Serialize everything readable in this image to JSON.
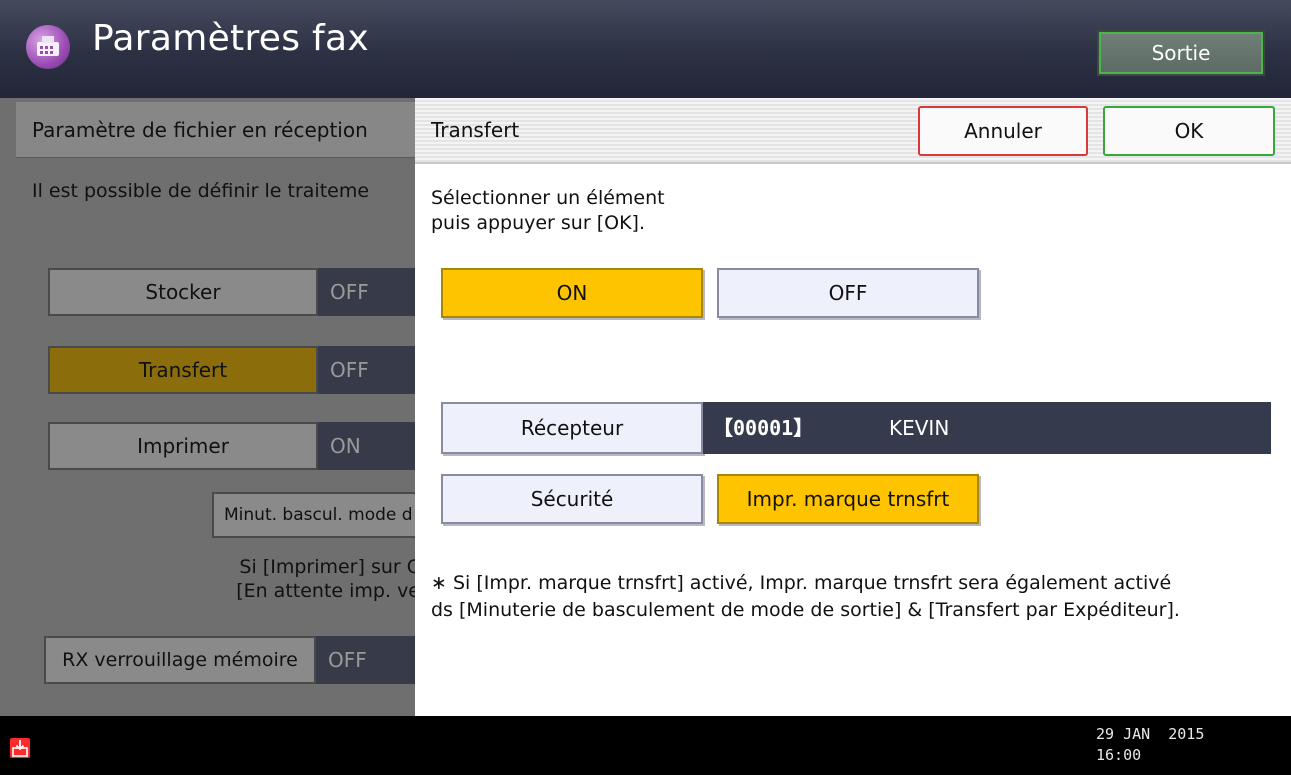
{
  "header": {
    "title": "Paramètres fax",
    "exit_label": "Sortie",
    "icon": "fax-icon"
  },
  "background_panel": {
    "title": "Paramètre de fichier en réception",
    "description": "Il est possible de définir le traiteme",
    "settings": [
      {
        "label": "Stocker",
        "value": "OFF",
        "selected": false
      },
      {
        "label": "Transfert",
        "value": "OFF",
        "selected": true
      },
      {
        "label": "Imprimer",
        "value": "ON",
        "selected": false
      }
    ],
    "sub_button_label": "Minut. bascul. mode d",
    "note_line1": "Si [Imprimer] sur C",
    "note_line2": "[En attente imp. ve",
    "memory_lock": {
      "label": "RX verrouillage mémoire",
      "value": "OFF"
    }
  },
  "dialog": {
    "title": "Transfert",
    "cancel_label": "Annuler",
    "ok_label": "OK",
    "instruction_line1": "Sélectionner un élément",
    "instruction_line2": "puis appuyer sur [OK].",
    "on_label": "ON",
    "off_label": "OFF",
    "selected_option": "ON",
    "receiver_label": "Récepteur",
    "receiver_number": "【00001】",
    "receiver_name": "KEVIN",
    "security_label": "Sécurité",
    "stamp_label": "Impr. marque trnsfrt",
    "note_line1": "∗ Si [Impr. marque trnsfrt] activé, Impr. marque trnsfrt sera également activé",
    "note_line2": "ds [Minuterie de basculement de mode de sortie] & [Transfert par Expéditeur]."
  },
  "footer": {
    "date": "29 JAN  2015",
    "time": "16:00",
    "icon": "inbox-alert-icon"
  },
  "colors": {
    "selected_yellow": "#ffc400",
    "cancel_border": "#d63a3a",
    "ok_border": "#38a83a",
    "header_bg": "#2c3043"
  }
}
